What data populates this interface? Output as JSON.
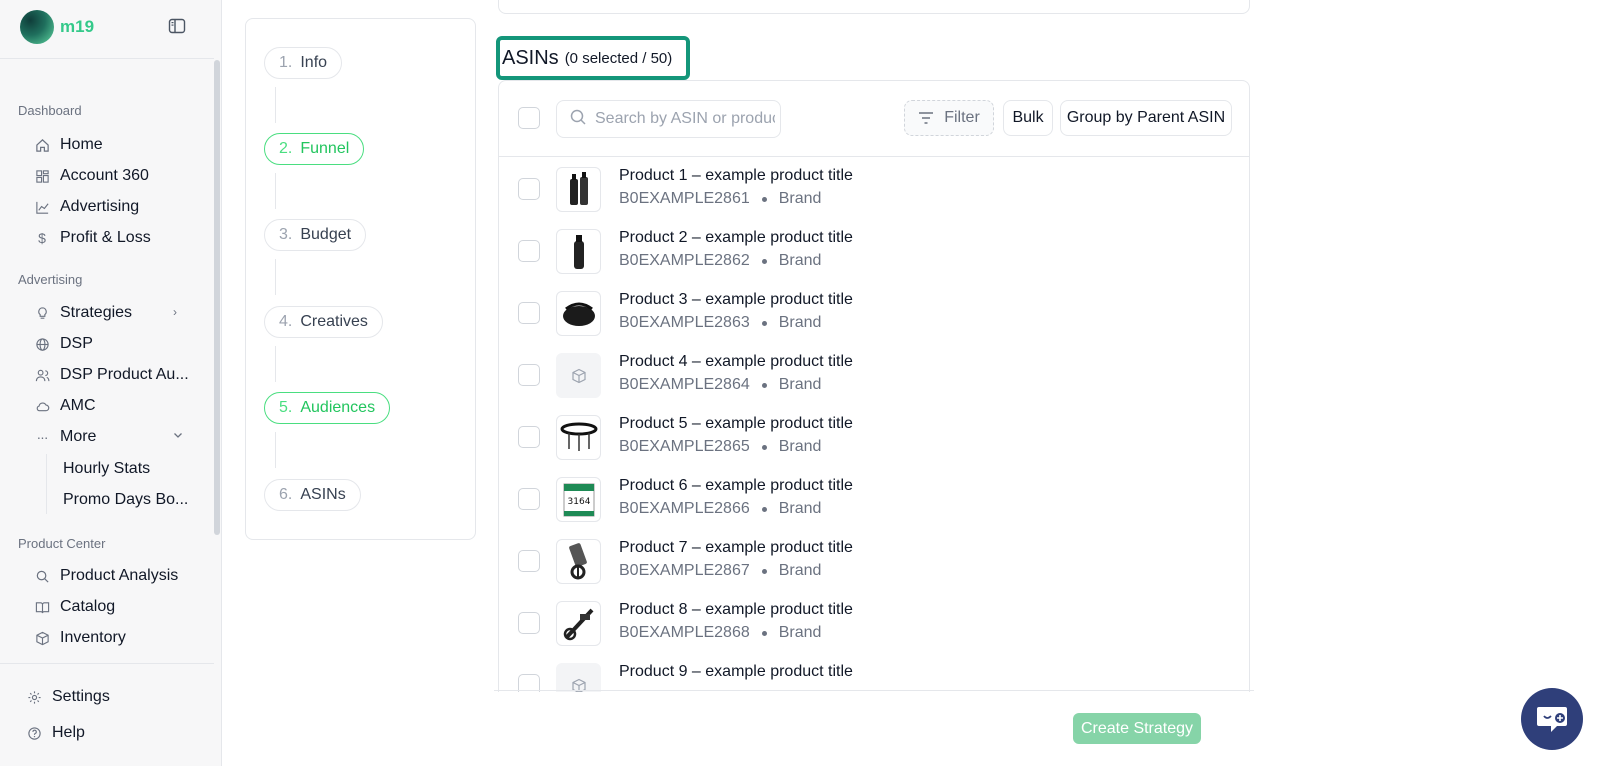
{
  "brand": {
    "name": "m19"
  },
  "sidebar": {
    "sections": {
      "dashboard": "Dashboard",
      "advertising": "Advertising",
      "product_center": "Product Center"
    },
    "items": {
      "home": "Home",
      "account360": "Account 360",
      "advertising": "Advertising",
      "profit_loss": "Profit & Loss",
      "strategies": "Strategies",
      "dsp": "DSP",
      "dsp_product_audiences": "DSP Product Au...",
      "amc": "AMC",
      "more": "More",
      "hourly_stats": "Hourly Stats",
      "promo_days": "Promo Days Bo...",
      "product_analysis": "Product Analysis",
      "catalog": "Catalog",
      "inventory": "Inventory",
      "settings": "Settings",
      "help": "Help"
    }
  },
  "steps": [
    {
      "num": "1.",
      "label": "Info",
      "active": false
    },
    {
      "num": "2.",
      "label": "Funnel",
      "active": true
    },
    {
      "num": "3.",
      "label": "Budget",
      "active": false
    },
    {
      "num": "4.",
      "label": "Creatives",
      "active": false
    },
    {
      "num": "5.",
      "label": "Audiences",
      "active": true
    },
    {
      "num": "6.",
      "label": "ASINs",
      "active": false
    }
  ],
  "asins": {
    "title": "ASINs",
    "count": "(0 selected / 50)",
    "search_placeholder": "Search by ASIN or product",
    "filter_label": "Filter",
    "bulk_label": "Bulk",
    "group_label": "Group by Parent ASIN"
  },
  "products": [
    {
      "title": "Product 1 – example product title",
      "asin": "B0EXAMPLE2861",
      "brand": "Brand",
      "image": "bottle-pair"
    },
    {
      "title": "Product 2 – example product title",
      "asin": "B0EXAMPLE2862",
      "brand": "Brand",
      "image": "bottle"
    },
    {
      "title": "Product 3 – example product title",
      "asin": "B0EXAMPLE2863",
      "brand": "Brand",
      "image": "bag"
    },
    {
      "title": "Product 4 – example product title",
      "asin": "B0EXAMPLE2864",
      "brand": "Brand",
      "image": "placeholder"
    },
    {
      "title": "Product 5 – example product title",
      "asin": "B0EXAMPLE2865",
      "brand": "Brand",
      "image": "belt"
    },
    {
      "title": "Product 6 – example product title",
      "asin": "B0EXAMPLE2866",
      "brand": "Brand",
      "image": "bib"
    },
    {
      "title": "Product 7 – example product title",
      "asin": "B0EXAMPLE2867",
      "brand": "Brand",
      "image": "phone-mount"
    },
    {
      "title": "Product 8 – example product title",
      "asin": "B0EXAMPLE2868",
      "brand": "Brand",
      "image": "bike-mount"
    },
    {
      "title": "Product 9 – example product title",
      "asin": "",
      "brand": "",
      "image": "placeholder"
    }
  ],
  "actions": {
    "create_strategy": "Create Strategy"
  },
  "colors": {
    "accent": "#22c55e",
    "highlight": "#14967a",
    "create_button": "#86d4a8",
    "chat_button": "#2f3f7a"
  }
}
